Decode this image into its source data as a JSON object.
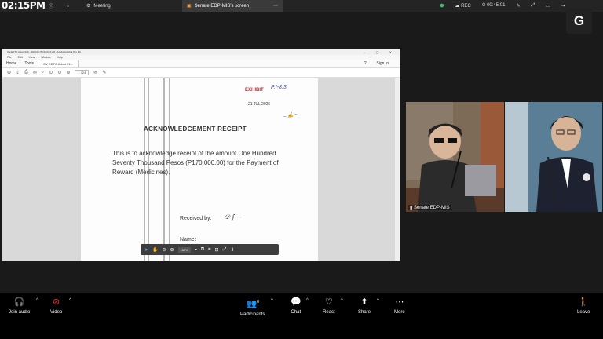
{
  "topbar": {
    "clock": "02:15PM",
    "meeting_label": "Meeting",
    "screen_tab_label": "Senate EDP-MIS's screen",
    "rec_label": "REC",
    "timer": "00:45:01",
    "profile_initial": "G"
  },
  "pdf": {
    "window_title": "OV-EDTC Acted 010 - RESOLUTION/ACT.pdf - Adobe Acrobat Pro DC",
    "menu": [
      "File",
      "Edit",
      "View",
      "Window",
      "Help"
    ],
    "tabs": [
      "Home",
      "Tools"
    ],
    "doc_tab": "OV EDTC Acted 01...",
    "sign_in": "Sign In",
    "page_box": "1 / 24",
    "zoom_level": "100%"
  },
  "document": {
    "exhibit_stamp": "EXHIBIT",
    "exhibit_number": "P.I-8.3",
    "date_stamp": "21 JUL 2025",
    "heading": "ACKNOWLEDGEMENT RECEIPT",
    "body": "This is to acknowledge receipt of the amount One Hundred Seventy Thousand Pesos (P170,000.00) for the Payment of Reward (Medicines).",
    "received_by": "Received by:",
    "name_label": "Name:"
  },
  "video": {
    "participant_label": "Senate EDP-MIS"
  },
  "bottombar": {
    "join_audio": "Join audio",
    "video": "Video",
    "participants": "Participants",
    "participants_count": "8",
    "chat": "Chat",
    "react": "React",
    "share": "Share",
    "more": "More",
    "leave": "Leave"
  }
}
